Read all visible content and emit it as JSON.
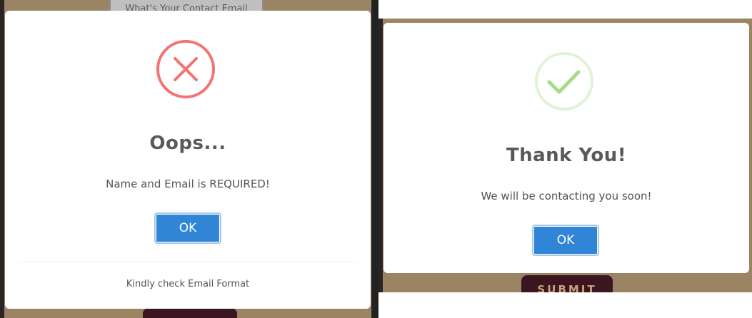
{
  "left": {
    "background_field_text": "What's Your Contact Email",
    "dialog": {
      "icon": "error-x-icon",
      "title": "Oops...",
      "text": "Name and Email is REQUIRED!",
      "ok_label": "OK",
      "footer": "Kindly check Email Format"
    }
  },
  "right": {
    "dialog": {
      "icon": "success-check-icon",
      "title": "Thank You!",
      "text": "We will be contacting you soon!",
      "ok_label": "OK"
    },
    "background_submit_label": "SUBMIT"
  },
  "colors": {
    "page_background": "#9b8463",
    "error": "#f27474",
    "success": "#a5dc86",
    "confirm_button": "#3085d6"
  }
}
